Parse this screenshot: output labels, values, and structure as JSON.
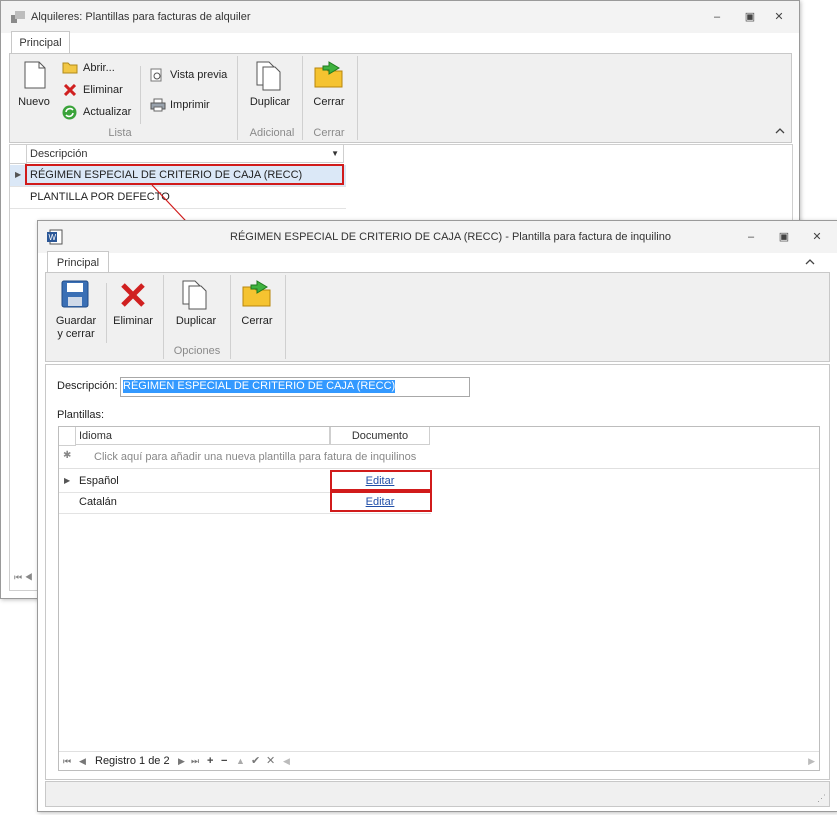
{
  "back_window": {
    "title": "Alquileres: Plantillas para facturas de alquiler",
    "tab": "Principal",
    "buttons": {
      "nuevo": "Nuevo",
      "abrir": "Abrir...",
      "eliminar": "Eliminar",
      "actualizar": "Actualizar",
      "vista_previa": "Vista previa",
      "imprimir": "Imprimir",
      "duplicar": "Duplicar",
      "cerrar": "Cerrar"
    },
    "groups": {
      "lista": "Lista",
      "adicional": "Adicional",
      "cerrar": "Cerrar"
    },
    "grid": {
      "column": "Descripción",
      "rows": [
        "RÉGIMEN ESPECIAL DE CRITERIO DE CAJA (RECC)",
        "PLANTILLA POR DEFECTO"
      ]
    }
  },
  "front_window": {
    "title": "RÉGIMEN ESPECIAL DE CRITERIO DE CAJA (RECC) - Plantilla para factura de inquilino",
    "tab": "Principal",
    "buttons": {
      "guardar_line1": "Guardar",
      "guardar_line2": "y cerrar",
      "eliminar": "Eliminar",
      "duplicar": "Duplicar",
      "cerrar": "Cerrar"
    },
    "groups": {
      "opciones": "Opciones"
    },
    "form": {
      "descripcion_label": "Descripción:",
      "descripcion_value": "RÉGIMEN ESPECIAL DE CRITERIO DE CAJA (RECC)",
      "plantillas_label": "Plantillas:"
    },
    "grid": {
      "columns": [
        "Idioma",
        "Documento"
      ],
      "new_row_hint": "Click aquí para añadir una nueva plantilla para fatura de inquilinos",
      "rows": [
        {
          "idioma": "Español",
          "documento": "Editar"
        },
        {
          "idioma": "Catalán",
          "documento": "Editar"
        }
      ],
      "navigator": "Registro 1 de 2"
    }
  },
  "colors": {
    "highlight": "#d11b1b",
    "selection": "#3399ff",
    "link": "#1f4ea8"
  }
}
